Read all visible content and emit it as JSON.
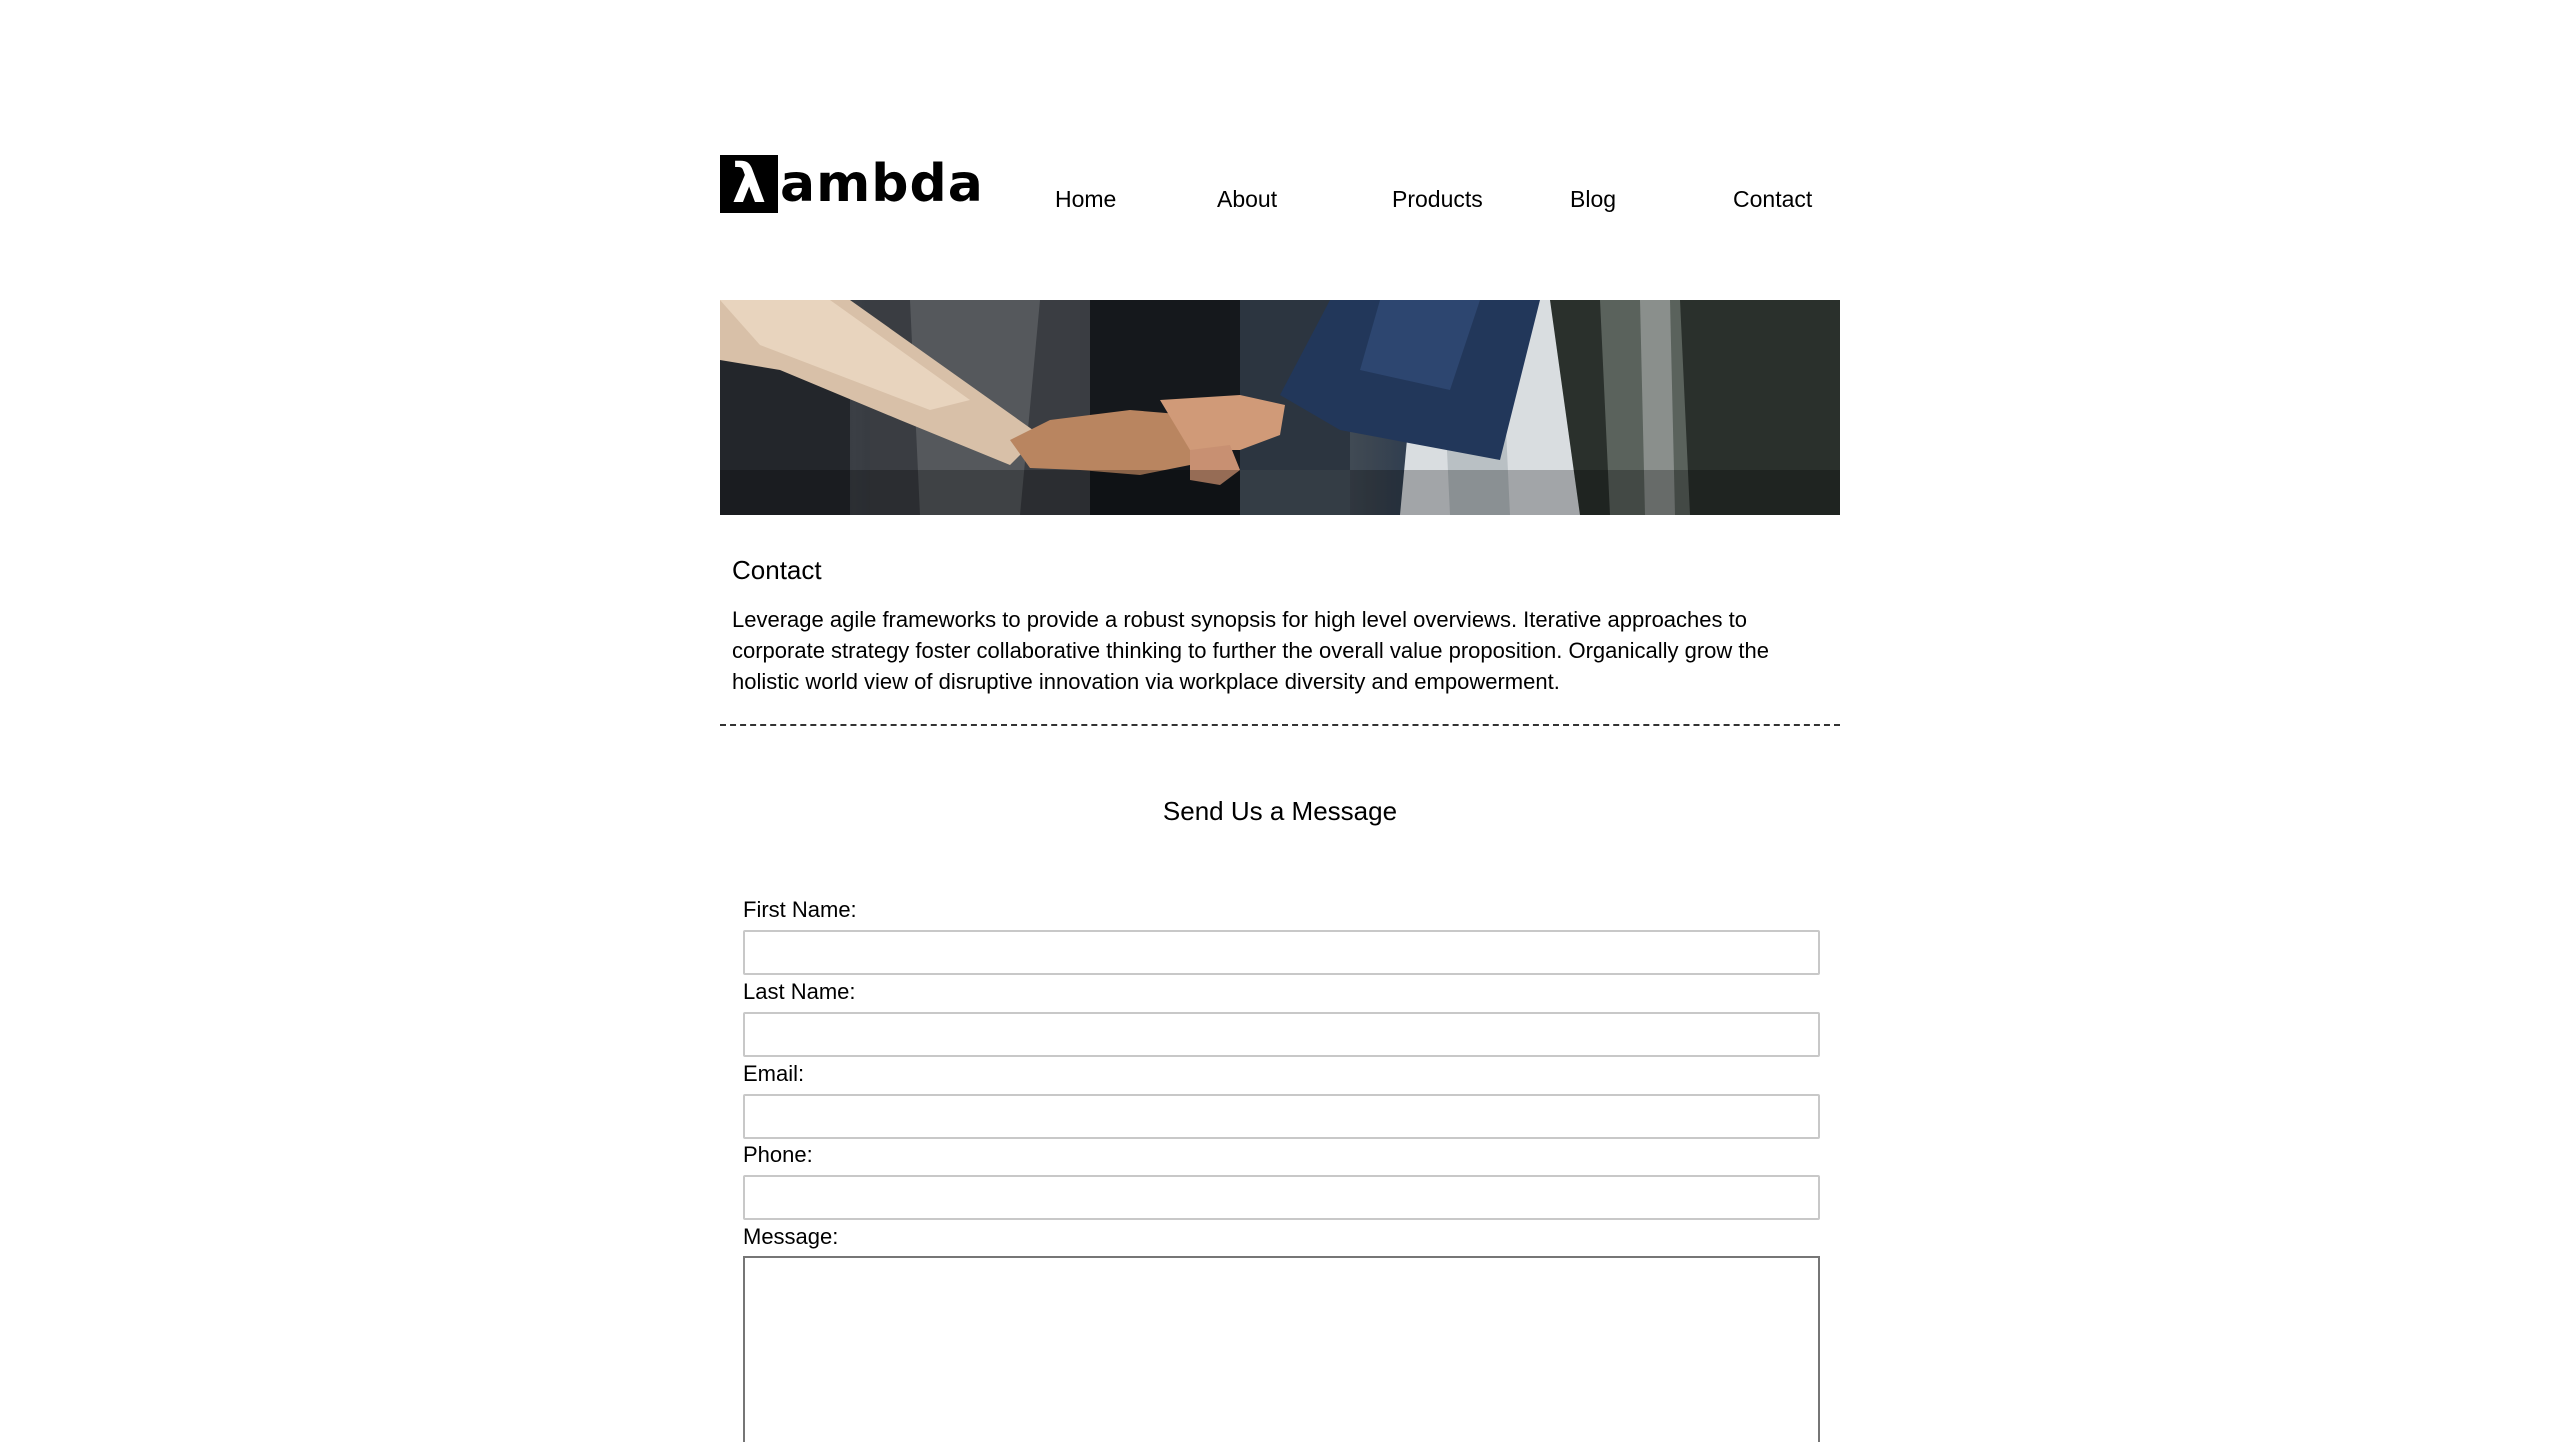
{
  "header": {
    "logo_symbol": "λ",
    "logo_text": "ambda",
    "nav": {
      "home": "Home",
      "about": "About",
      "products": "Products",
      "blog": "Blog",
      "contact": "Contact"
    }
  },
  "hero": {
    "icon": "handshake-photo"
  },
  "content": {
    "title": "Contact",
    "intro": "Leverage agile frameworks to provide a robust synopsis for high level overviews. Iterative approaches to corporate strategy foster collaborative thinking to further the overall value proposition. Organically grow the holistic world view of disruptive innovation via workplace diversity and empowerment."
  },
  "form": {
    "heading": "Send Us a Message",
    "first_name_label": "First Name:",
    "first_name_value": "",
    "last_name_label": "Last Name:",
    "last_name_value": "",
    "email_label": "Email:",
    "email_value": "",
    "phone_label": "Phone:",
    "phone_value": "",
    "message_label": "Message:",
    "message_value": ""
  }
}
